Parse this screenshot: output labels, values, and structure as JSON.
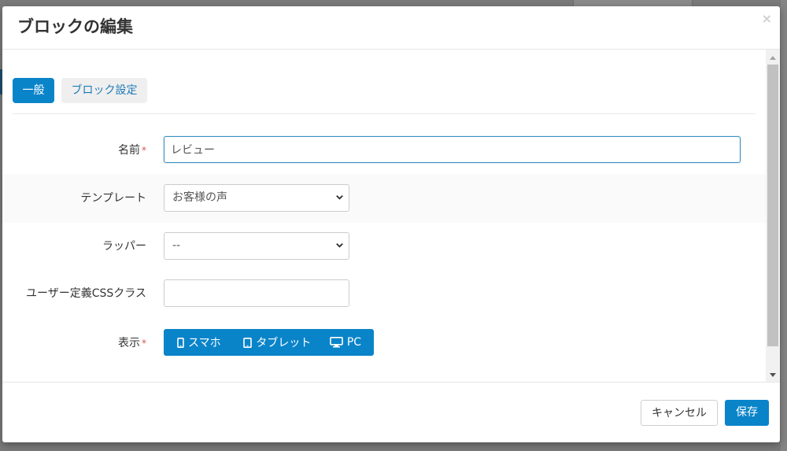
{
  "modal": {
    "title": "ブロックの編集",
    "close_label": "×"
  },
  "tabs": [
    {
      "label": "一般",
      "active": true
    },
    {
      "label": "ブロック設定",
      "active": false
    }
  ],
  "form": {
    "name": {
      "label": "名前",
      "required_mark": "*",
      "value": "レビュー"
    },
    "template": {
      "label": "テンプレート",
      "selected": "お客様の声"
    },
    "wrapper": {
      "label": "ラッパー",
      "selected": "--"
    },
    "css_class": {
      "label": "ユーザー定義CSSクラス",
      "value": ""
    },
    "display": {
      "label": "表示",
      "required_mark": "*",
      "options": [
        {
          "label": "スマホ",
          "icon": "smartphone-icon"
        },
        {
          "label": "タブレット",
          "icon": "tablet-icon"
        },
        {
          "label": "PC",
          "icon": "desktop-icon"
        }
      ]
    }
  },
  "footer": {
    "cancel_label": "キャンセル",
    "save_label": "保存"
  },
  "colors": {
    "primary": "#0a84c9",
    "required": "#d9534f",
    "focus_border": "#3a8fc5"
  }
}
